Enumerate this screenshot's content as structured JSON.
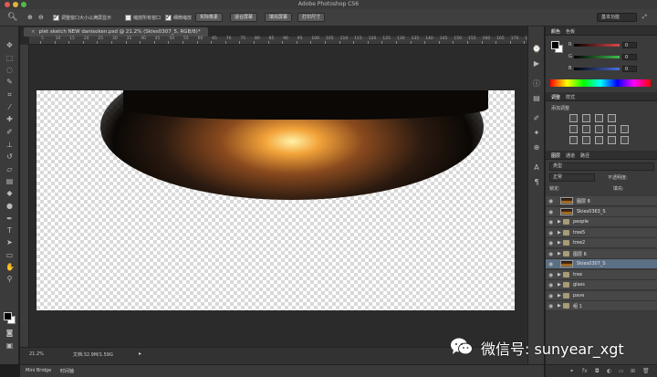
{
  "app": {
    "title": "Adobe Photoshop CS6"
  },
  "options_bar": {
    "resize_windows_label": "调整窗口大小以满屏显示",
    "zoom_all_windows_label": "缩放所有窗口",
    "scrubby_zoom_label": "细微缩放",
    "actual_pixels_btn": "实际像素",
    "fit_screen_btn": "适合屏幕",
    "fill_screen_btn": "填充屏幕",
    "print_size_btn": "打印尺寸",
    "workspace": "基本功能"
  },
  "document": {
    "tab_title": "plet sketch NEW danisoken.psd @ 21.2% (Skies0307_5, RGB/8)",
    "tab_modified": "*",
    "ruler_labels": [
      "5",
      "10",
      "15",
      "20",
      "25",
      "30",
      "35",
      "40",
      "45",
      "50",
      "55",
      "60",
      "65",
      "70",
      "75",
      "80",
      "85",
      "90",
      "95",
      "100",
      "105",
      "110",
      "115",
      "120",
      "125",
      "130",
      "135",
      "140",
      "145",
      "150",
      "155",
      "160",
      "165",
      "170",
      "175"
    ],
    "zoom": "21.2%",
    "doc_info": "文档:32.9M/1.59G"
  },
  "bottom_tabs": {
    "mini_bridge": "Mini Bridge",
    "timeline": "时间轴"
  },
  "color_panel": {
    "tabs": [
      "颜色",
      "色板"
    ],
    "channels": [
      {
        "label": "R",
        "value": "0",
        "color": "#e04646"
      },
      {
        "label": "G",
        "value": "0",
        "color": "#3fbf4f"
      },
      {
        "label": "B",
        "value": "0",
        "color": "#4a6fe0"
      }
    ]
  },
  "adjustments_panel": {
    "tabs": [
      "调整",
      "样式"
    ],
    "title": "添加调整"
  },
  "layers_panel": {
    "tabs": [
      "图层",
      "通道",
      "路径"
    ],
    "filter_label": "类型",
    "blend_mode": "正常",
    "opacity_label": "不透明度:",
    "lock_label": "锁定:",
    "fill_label": "填充:",
    "layers": [
      {
        "name": "图层 8",
        "type": "pixel",
        "selected": false
      },
      {
        "name": "Skies0363_S",
        "type": "pixel",
        "selected": false
      },
      {
        "name": "people",
        "type": "group",
        "selected": false
      },
      {
        "name": "tree5",
        "type": "group",
        "selected": false
      },
      {
        "name": "tree2",
        "type": "group",
        "selected": false
      },
      {
        "name": "图层 6",
        "type": "group",
        "selected": false
      },
      {
        "name": "Skies0307_S",
        "type": "pixel",
        "selected": true
      },
      {
        "name": "tree",
        "type": "group",
        "selected": false
      },
      {
        "name": "glass",
        "type": "group",
        "selected": false
      },
      {
        "name": "pave",
        "type": "group",
        "selected": false
      },
      {
        "name": "组 1",
        "type": "group",
        "selected": false
      }
    ]
  },
  "watermark": {
    "text": "微信号: sunyear_xgt"
  }
}
